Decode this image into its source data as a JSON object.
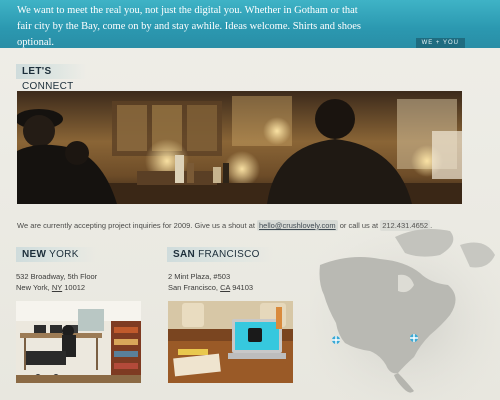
{
  "banner": {
    "text": "We want to meet the real you, not just the digital you. Whether in Gotham or that fair city by the Bay, come on by and stay awhile. Ideas welcome. Shirts and shoes optional.",
    "tab_label": "WE + YOU"
  },
  "connect": {
    "heading_bold": "LET'S",
    "heading_rest": " CONNECT"
  },
  "inquiry": {
    "prefix": "We are currently accepting project inquiries for 2009. Give us a shout at ",
    "email": "hello@crushlovely.com",
    "middle": " or call us at ",
    "phone": "212.431.4652",
    "suffix": "."
  },
  "new_york": {
    "heading_bold": "NEW",
    "heading_rest": " YORK",
    "address_line1": "532 Broadway, 5th Floor",
    "city": "New York, ",
    "state": "NY",
    "zip": " 10012"
  },
  "san_francisco": {
    "heading_bold": "SAN",
    "heading_rest": " FRANCISCO",
    "address_line1": "2 Mint Plaza, #503",
    "city": "San Francisco, ",
    "state": "CA",
    "zip": " 94103"
  },
  "colors": {
    "banner": "#2b98b0",
    "tab": "#1f6c80",
    "page_bg": "#ecebe4",
    "marker": "#3aa9d6"
  },
  "icons": {
    "map_marker": "plus-marker-icon"
  }
}
